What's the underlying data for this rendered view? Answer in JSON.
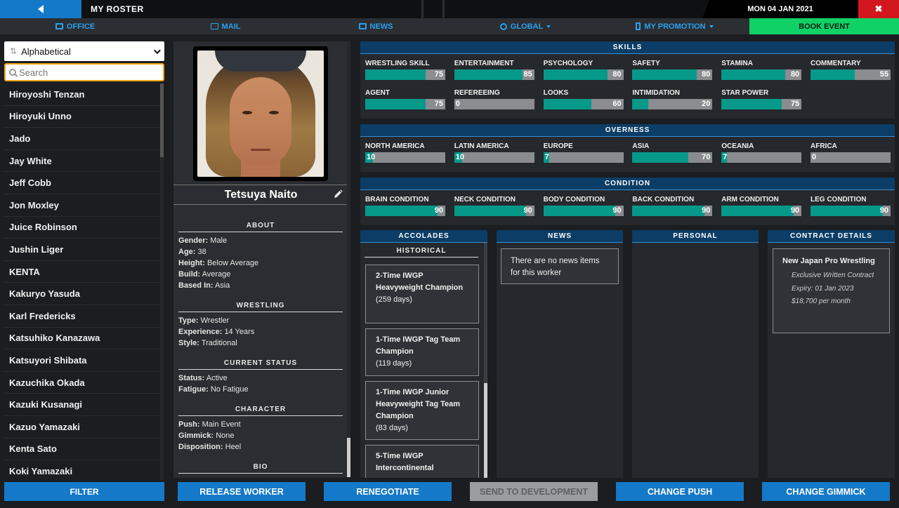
{
  "titlebar": {
    "title": "MY ROSTER",
    "date": "MON 04 JAN 2021",
    "close_glyph": "✖"
  },
  "nav": {
    "office": "OFFICE",
    "mail": "MAIL",
    "news": "NEWS",
    "global": "GLOBAL",
    "my_promotion": "MY PROMOTION",
    "book_event": "BOOK EVENT"
  },
  "sort": {
    "selected": "Alphabetical"
  },
  "search": {
    "placeholder": "Search",
    "value": ""
  },
  "workers": [
    "Hiroyoshi Tenzan",
    "Hiroyuki Unno",
    "Jado",
    "Jay White",
    "Jeff Cobb",
    "Jon Moxley",
    "Juice Robinson",
    "Jushin Liger",
    "KENTA",
    "Kakuryo Yasuda",
    "Karl Fredericks",
    "Katsuhiko Kanazawa",
    "Katsuyori Shibata",
    "Kazuchika Okada",
    "Kazuki Kusanagi",
    "Kazuo Yamazaki",
    "Kenta Sato",
    "Koki Yamazaki"
  ],
  "filter_label": "FILTER",
  "profile": {
    "name": "Tetsuya Naito",
    "about": {
      "heading": "ABOUT",
      "rows": [
        {
          "k": "Gender:",
          "v": "Male"
        },
        {
          "k": "Age:",
          "v": "38"
        },
        {
          "k": "Height:",
          "v": "Below Average"
        },
        {
          "k": "Build:",
          "v": "Average"
        },
        {
          "k": "Based In:",
          "v": "Asia"
        }
      ]
    },
    "wrestling": {
      "heading": "WRESTLING",
      "rows": [
        {
          "k": "Type:",
          "v": "Wrestler"
        },
        {
          "k": "Experience:",
          "v": "14 Years"
        },
        {
          "k": "Style:",
          "v": "Traditional"
        }
      ]
    },
    "status": {
      "heading": "CURRENT STATUS",
      "rows": [
        {
          "k": "Status:",
          "v": "Active"
        },
        {
          "k": "Fatigue:",
          "v": "No Fatigue"
        }
      ]
    },
    "character": {
      "heading": "CHARACTER",
      "rows": [
        {
          "k": "Push:",
          "v": "Main Event"
        },
        {
          "k": "Gimmick:",
          "v": "None"
        },
        {
          "k": "Disposition:",
          "v": "Heel"
        }
      ]
    },
    "bio": {
      "heading": "BIO"
    }
  },
  "skills": {
    "heading": "SKILLS",
    "items": [
      {
        "label": "WRESTLING SKILL",
        "value": 75
      },
      {
        "label": "ENTERTAINMENT",
        "value": 85
      },
      {
        "label": "PSYCHOLOGY",
        "value": 80
      },
      {
        "label": "SAFETY",
        "value": 80
      },
      {
        "label": "STAMINA",
        "value": 80
      },
      {
        "label": "COMMENTARY",
        "value": 55
      },
      {
        "label": "AGENT",
        "value": 75
      },
      {
        "label": "REFEREEING",
        "value": 0
      },
      {
        "label": "LOOKS",
        "value": 60
      },
      {
        "label": "INTIMIDATION",
        "value": 20
      },
      {
        "label": "STAR POWER",
        "value": 75
      }
    ]
  },
  "overness": {
    "heading": "OVERNESS",
    "items": [
      {
        "label": "NORTH AMERICA",
        "value": 10
      },
      {
        "label": "LATIN AMERICA",
        "value": 10
      },
      {
        "label": "EUROPE",
        "value": 7
      },
      {
        "label": "ASIA",
        "value": 70
      },
      {
        "label": "OCEANIA",
        "value": 7
      },
      {
        "label": "AFRICA",
        "value": 0
      }
    ]
  },
  "condition": {
    "heading": "CONDITION",
    "items": [
      {
        "label": "BRAIN CONDITION",
        "value": 90
      },
      {
        "label": "NECK CONDITION",
        "value": 90
      },
      {
        "label": "BODY CONDITION",
        "value": 90
      },
      {
        "label": "BACK CONDITION",
        "value": 90
      },
      {
        "label": "ARM CONDITION",
        "value": 90
      },
      {
        "label": "LEG CONDITION",
        "value": 90
      }
    ]
  },
  "accolades": {
    "heading": "ACCOLADES",
    "sub": "HISTORICAL",
    "items": [
      {
        "title": "2-Time IWGP Heavyweight Champion",
        "days": "(259 days)"
      },
      {
        "title": "1-Time IWGP Tag Team Champion",
        "days": "(119 days)"
      },
      {
        "title": "1-Time IWGP Junior Heavyweight Tag Team Champion",
        "days": "(83 days)"
      },
      {
        "title": "5-Time IWGP Intercontinental",
        "days": ""
      }
    ]
  },
  "news": {
    "heading": "NEWS",
    "empty": "There are no news items for this worker"
  },
  "personal": {
    "heading": "PERSONAL"
  },
  "contract": {
    "heading": "CONTRACT DETAILS",
    "company": "New Japan Pro Wrestling",
    "type": "Exclusive Written Contract",
    "expiry": "Expiry: 01 Jan 2023",
    "salary": "$18,700 per month"
  },
  "actions": {
    "release": "RELEASE WORKER",
    "renegotiate": "RENEGOTIATE",
    "development": "SEND TO DEVELOPMENT",
    "push": "CHANGE PUSH",
    "gimmick": "CHANGE GIMMICK"
  },
  "colors": {
    "accent": "#1479c9",
    "book": "#10d166",
    "bar_fill": "#06998a",
    "close": "#d3171e"
  }
}
